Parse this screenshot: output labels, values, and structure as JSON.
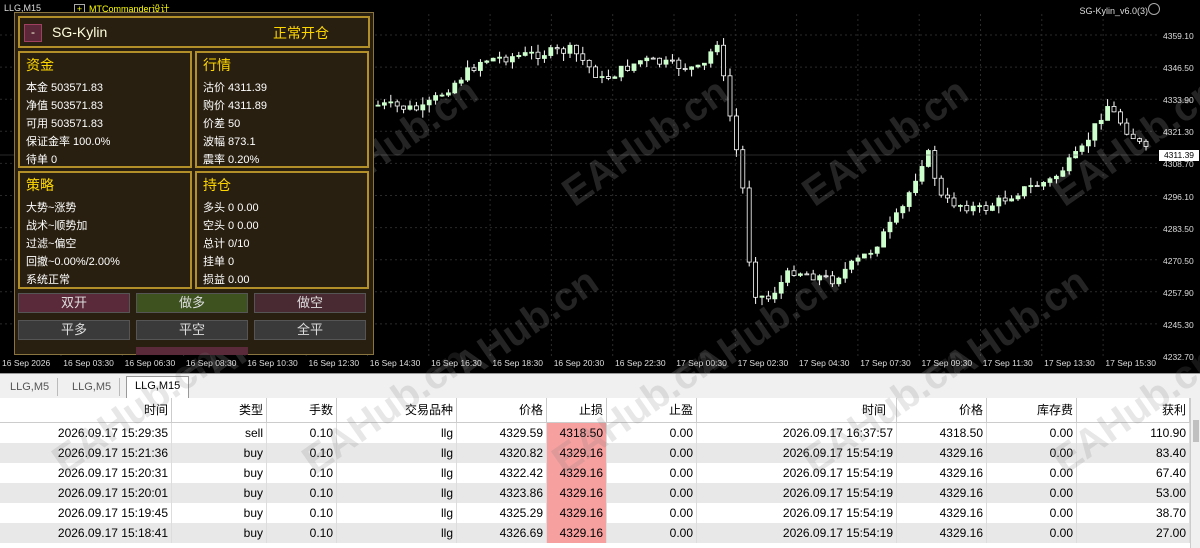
{
  "chart": {
    "symbol_label": "LLG,M15",
    "indicator_label": "MTCommander",
    "indicator_label_cn": "设计",
    "ea_label": "SG-Kylin_v6.0(3)",
    "current_price": "4311.39",
    "price_ticks": [
      "4359.10",
      "4346.50",
      "4333.90",
      "4321.30",
      "4308.70",
      "4296.10",
      "4283.50",
      "4270.50",
      "4257.90",
      "4245.30",
      "4232.70"
    ],
    "time_ticks": [
      "16 Sep 2026",
      "16 Sep 03:30",
      "16 Sep 06:30",
      "16 Sep 08:30",
      "16 Sep 10:30",
      "16 Sep 12:30",
      "16 Sep 14:30",
      "16 Sep 16:30",
      "16 Sep 18:30",
      "16 Sep 20:30",
      "16 Sep 22:30",
      "17 Sep 00:30",
      "17 Sep 02:30",
      "17 Sep 04:30",
      "17 Sep 07:30",
      "17 Sep 09:30",
      "17 Sep 11:30",
      "17 Sep 13:30",
      "17 Sep 15:30"
    ],
    "watermark": "EAHub.cn",
    "colors": {
      "bull": "#ffffff",
      "bear": "#ffffff",
      "bull_fill": "#ccffcc",
      "grid": "#2a2a2a"
    }
  },
  "panel": {
    "min_button": "-",
    "name": "SG-Kylin",
    "status": "正常开仓",
    "funds": {
      "title": "资金",
      "rows": [
        "本金 503571.83",
        "净值 503571.83",
        "可用 503571.83",
        "保证金率 100.0%",
        "待单 0"
      ]
    },
    "market": {
      "title": "行情",
      "rows": [
        "沽价 4311.39",
        "购价 4311.89",
        "价差 50",
        "波幅 873.1",
        "震率 0.20%"
      ]
    },
    "strategy": {
      "title": "策略",
      "rows": [
        "大势~涨势",
        "战术~顺势加",
        "过滤~偏空",
        "回撤~0.00%/2.00%",
        "系统正常"
      ]
    },
    "positions": {
      "title": "持仓",
      "rows": [
        "多头 0 0.00",
        "空头 0 0.00",
        "总计 0/10",
        "挂单 0",
        "损益 0.00"
      ]
    },
    "buttons": {
      "double_open": "双开",
      "buy": "做多",
      "sell": "做空",
      "close_long": "平多",
      "close_short": "平空",
      "close_all": "全平"
    }
  },
  "tabs": [
    "LLG,M5",
    "LLG,M5",
    "LLG,M15"
  ],
  "table": {
    "headers": [
      "时间",
      "类型",
      "手数",
      "交易品种",
      "价格",
      "止损",
      "止盈",
      "时间",
      "价格",
      "库存费",
      "获利"
    ],
    "rows": [
      [
        "2026.09.17 15:29:35",
        "sell",
        "0.10",
        "llg",
        "4329.59",
        "4318.50",
        "0.00",
        "2026.09.17 16:37:57",
        "4318.50",
        "0.00",
        "110.90"
      ],
      [
        "2026.09.17 15:21:36",
        "buy",
        "0.10",
        "llg",
        "4320.82",
        "4329.16",
        "0.00",
        "2026.09.17 15:54:19",
        "4329.16",
        "0.00",
        "83.40"
      ],
      [
        "2026.09.17 15:20:31",
        "buy",
        "0.10",
        "llg",
        "4322.42",
        "4329.16",
        "0.00",
        "2026.09.17 15:54:19",
        "4329.16",
        "0.00",
        "67.40"
      ],
      [
        "2026.09.17 15:20:01",
        "buy",
        "0.10",
        "llg",
        "4323.86",
        "4329.16",
        "0.00",
        "2026.09.17 15:54:19",
        "4329.16",
        "0.00",
        "53.00"
      ],
      [
        "2026.09.17 15:19:45",
        "buy",
        "0.10",
        "llg",
        "4325.29",
        "4329.16",
        "0.00",
        "2026.09.17 15:54:19",
        "4329.16",
        "0.00",
        "38.70"
      ],
      [
        "2026.09.17 15:18:41",
        "buy",
        "0.10",
        "llg",
        "4326.69",
        "4329.16",
        "0.00",
        "2026.09.17 15:54:19",
        "4329.16",
        "0.00",
        "27.00"
      ]
    ]
  }
}
